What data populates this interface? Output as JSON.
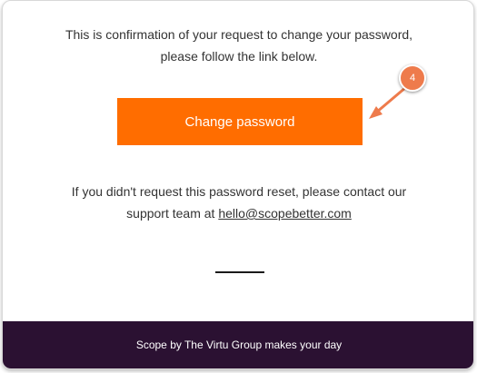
{
  "email": {
    "intro_line1": "This is confirmation of your request to change your password,",
    "intro_line2": "please follow the link below.",
    "button_label": "Change password",
    "help_line1": "If you didn't request this password reset, please contact our",
    "help_line2_prefix": "support team at ",
    "support_email": "hello@scopebetter.com",
    "footer_text": "Scope by The Virtu Group makes your day"
  },
  "annotation": {
    "step_number": "4",
    "color": "#ee7b4c"
  },
  "colors": {
    "button": "#ff6d00",
    "footer": "#2b1132",
    "text": "#333333"
  }
}
